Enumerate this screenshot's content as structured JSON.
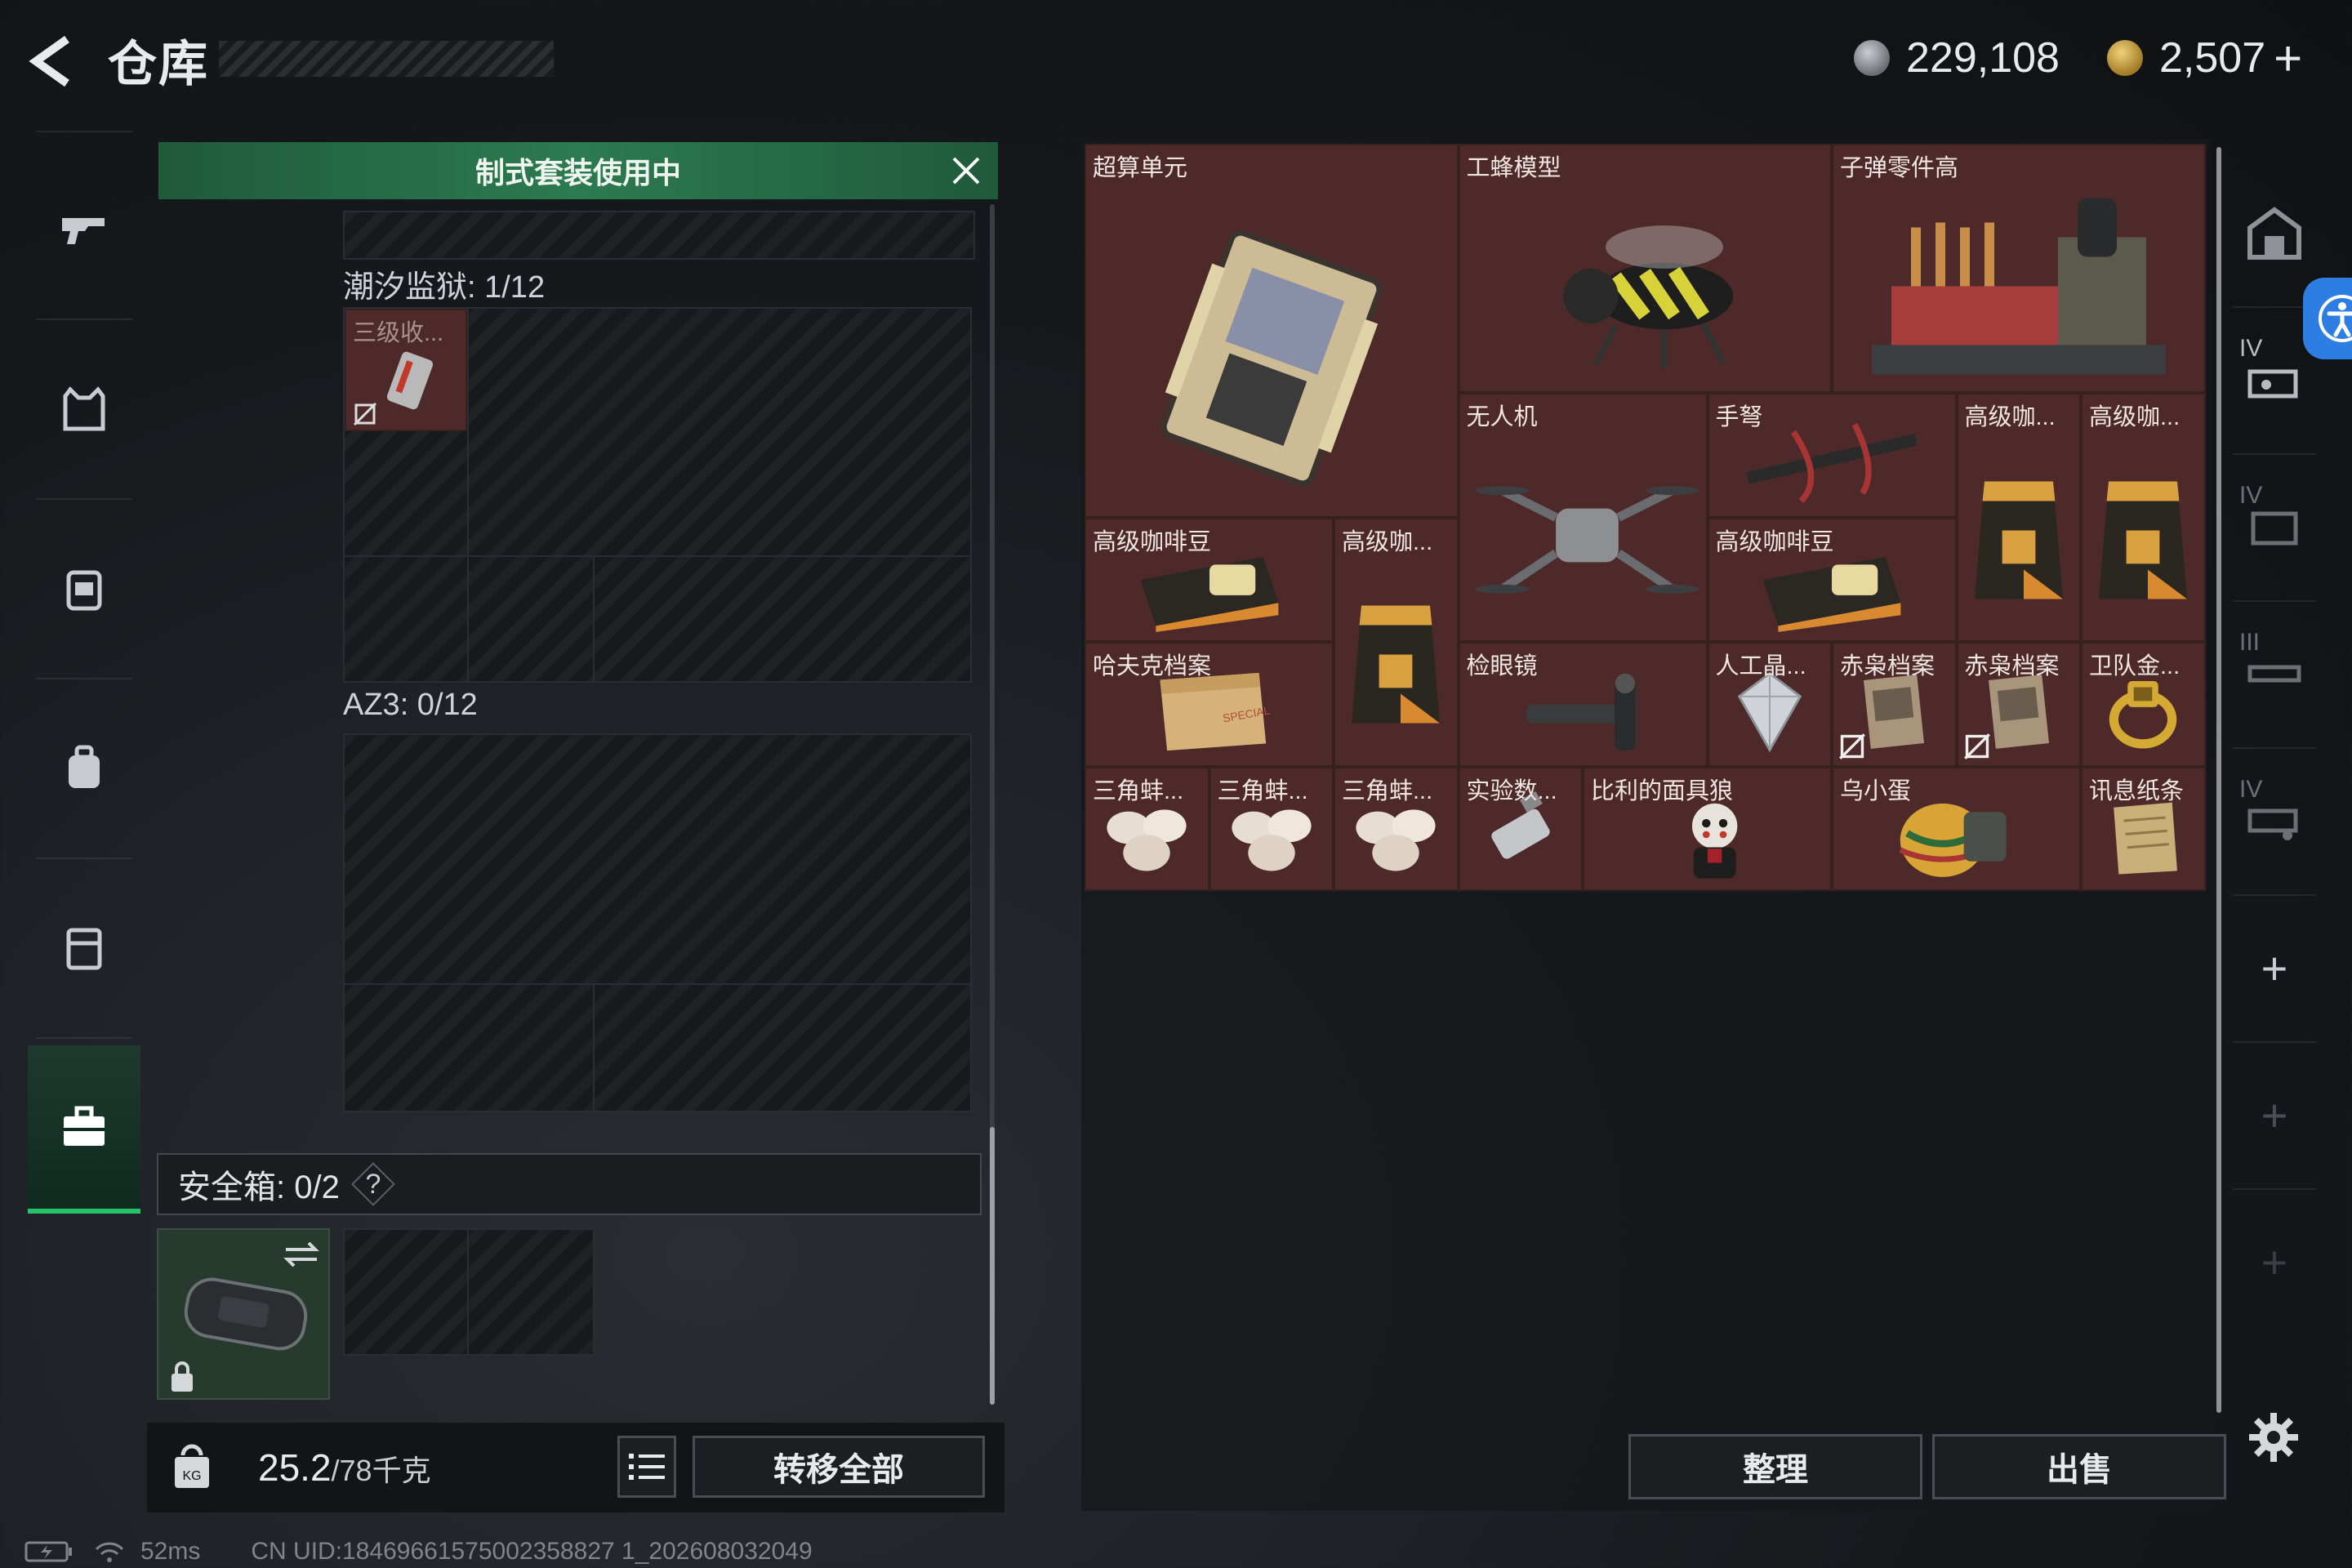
{
  "header": {
    "title": "仓库",
    "currencies": [
      {
        "name": "silver-coin-icon",
        "value": "229,108"
      },
      {
        "name": "gold-coin-icon",
        "value": "2,507"
      }
    ],
    "add_symbol": "+"
  },
  "left_nav": {
    "items": [
      "gun-icon",
      "armor-vest-icon",
      "backpack-icon",
      "chest-rig-icon",
      "container-icon",
      "briefcase-icon"
    ],
    "active": "briefcase-icon"
  },
  "loadout": {
    "banner": "制式套装使用中",
    "sections": [
      {
        "label": "潮汐监狱: 1/12",
        "items": [
          {
            "label": "三级收..."
          }
        ]
      },
      {
        "label": "AZ3: 0/12",
        "items": []
      }
    ],
    "safe_box": {
      "label": "安全箱:  0/2",
      "help": "?"
    },
    "weight": {
      "value": "25.2",
      "unit": "/78千克"
    },
    "transfer_all": "转移全部"
  },
  "stash": {
    "accent_color": "#4d2a29",
    "items": [
      {
        "label": "超算单元",
        "art": "chip"
      },
      {
        "label": "工蜂模型",
        "art": "bee"
      },
      {
        "label": "子弹零件高",
        "art": "crate"
      },
      {
        "label": "无人机",
        "art": "drone"
      },
      {
        "label": "手弩",
        "art": "crossbow"
      },
      {
        "label": "高级咖...",
        "art": "coffee-bag"
      },
      {
        "label": "高级咖...",
        "art": "coffee-bag"
      },
      {
        "label": "高级咖啡豆",
        "art": "coffee-box"
      },
      {
        "label": "高级咖...",
        "art": "coffee-bag"
      },
      {
        "label": "高级咖啡豆",
        "art": "coffee-box"
      },
      {
        "label": "哈夫克档案",
        "art": "file"
      },
      {
        "label": "检眼镜",
        "art": "scope"
      },
      {
        "label": "人工晶...",
        "art": "gem"
      },
      {
        "label": "赤枭档案",
        "art": "doc"
      },
      {
        "label": "赤枭档案",
        "art": "doc"
      },
      {
        "label": "卫队金...",
        "art": "ring"
      },
      {
        "label": "三角蚌...",
        "art": "pearls"
      },
      {
        "label": "三角蚌...",
        "art": "pearls"
      },
      {
        "label": "三角蚌...",
        "art": "pearls"
      },
      {
        "label": "实验数...",
        "art": "usb"
      },
      {
        "label": "比利的面具狼",
        "art": "doll"
      },
      {
        "label": "乌小蛋",
        "art": "egg"
      },
      {
        "label": "讯息纸条",
        "art": "note"
      }
    ],
    "sort_button": "整理",
    "sell_button": "出售"
  },
  "right_nav": {
    "tiers": [
      "IV",
      "III",
      "IV",
      "IV"
    ],
    "add_symbol": "+"
  },
  "status": {
    "latency": "52ms",
    "uid": "CN UID:18469661575002358827 1_202608032049"
  }
}
